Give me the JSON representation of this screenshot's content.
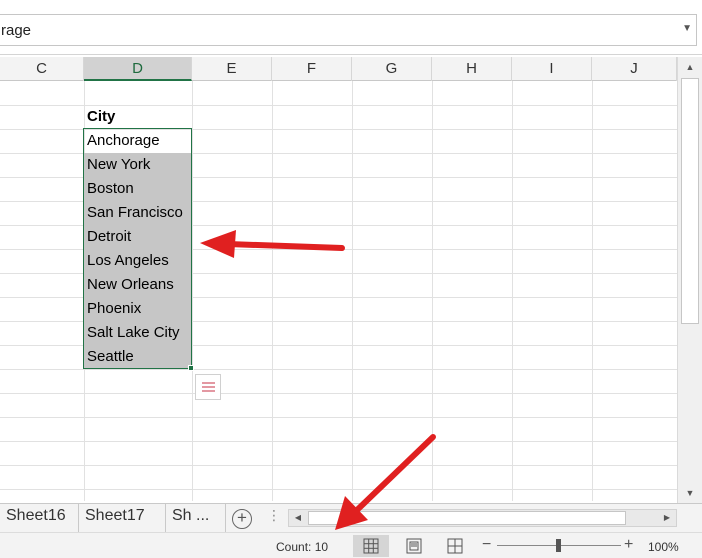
{
  "formula_bar": {
    "value": "rage",
    "expand_icon": "chevron-down-icon"
  },
  "columns": [
    "C",
    "D",
    "E",
    "F",
    "G",
    "H",
    "I",
    "J"
  ],
  "selected_column": "D",
  "column_d": {
    "header": "City",
    "cities": [
      "Anchorage",
      "New York",
      "Boston",
      "San Francisco",
      "Detroit",
      "Los Angeles",
      "New Orleans",
      "Phoenix",
      "Salt Lake City",
      "Seattle"
    ]
  },
  "sheet_tabs": [
    "Sheet16",
    "Sheet17",
    "Sh ..."
  ],
  "add_sheet_label": "+",
  "status_bar": {
    "count": "Count: 10",
    "zoom": "100%",
    "zoom_minus": "−",
    "zoom_plus": "+",
    "views": [
      "normal-view-icon",
      "page-layout-icon",
      "page-break-preview-icon"
    ]
  },
  "annotation_color": "#e02020",
  "selection_color": "#217346"
}
